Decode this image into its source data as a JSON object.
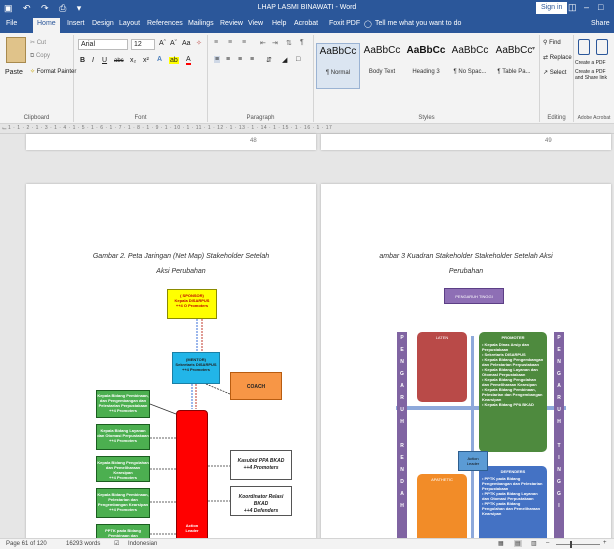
{
  "titlebar": {
    "qat": "▣ ↶ ↷ ⎙ ▾",
    "title": "LHAP LASMI BINAWATI - Word",
    "sign_in": "Sign in",
    "ribbon_display": "◫",
    "minimize": "–",
    "maximize": "□",
    "close": "✕"
  },
  "tabs": [
    "File",
    "Home",
    "Insert",
    "Design",
    "Layout",
    "References",
    "Mailings",
    "Review",
    "View",
    "Help",
    "Acrobat",
    "Foxit PDF"
  ],
  "tell_me": "Tell me what you want to do",
  "share": "Share",
  "clipboard": {
    "paste": "Paste",
    "cut": "Cut",
    "copy": "Copy",
    "format_painter": "Format Painter",
    "label": "Clipboard"
  },
  "font": {
    "name": "Arial",
    "size": "12",
    "grow": "Aˆ",
    "shrink": "Aˇ",
    "case": "Aa",
    "clear": "✧",
    "bold": "B",
    "italic": "I",
    "underline": "U",
    "strike": "abc",
    "subscript": "x₂",
    "superscript": "x²",
    "effects": "A",
    "highlight": "ab",
    "color": "A",
    "label": "Font"
  },
  "paragraph": {
    "label": "Paragraph"
  },
  "styles": {
    "items": [
      {
        "preview": "AaBbCc",
        "name": "¶ Normal"
      },
      {
        "preview": "AaBbCc",
        "name": "Body Text"
      },
      {
        "preview": "AaBbCc",
        "name": "Heading 3"
      },
      {
        "preview": "AaBbCc",
        "name": "¶ No Spac..."
      },
      {
        "preview": "AaBbCc",
        "name": "¶ Table Pa..."
      }
    ],
    "label": "Styles"
  },
  "editing": {
    "find": "Find",
    "replace": "Replace",
    "select": "Select",
    "label": "Editing"
  },
  "adobe": {
    "create_pdf": "Create a PDF",
    "create_share": "Create a PDF and Share link",
    "label": "Adobe Acrobat"
  },
  "ruler_ticks": "1 · 1 · 2 · 1 · 3 · 1 · 4 · 1 · 5 · 1 · 6 · 1 · 7 · 1 · 8 · 1 · 9 · 1 · 10 · 1 · 11 · 1 · 12 · 1 · 13 · 1 · 14 · 1 · 15 · 1 · 16 · 1 · 17",
  "pages": {
    "upper_left_number": "48",
    "upper_right_number": "49",
    "left": {
      "caption_line1": "Gambar 2. Peta Jaringan (Net Map) Stakeholder Setelah",
      "caption_line2": "Aksi Perubahan",
      "sponsor": "( SPONSOR)\nKepala DISARPUS\n++4 O Promoters",
      "mentor": "(MENTOR)\nSekretaris DISARPUS\n++4 Promoters",
      "coach": "COACH",
      "action_leader": "Action\nLeader",
      "left_boxes": [
        "Kepala Bidang Pembinaan, dan Pengembangan dan Pelestarian Perpustakaan\n++4 Promoters",
        "Kepala Bidang Layanan dan Otomasi Perpustakaan\n++4 Promoters",
        "Kepala Bidang Pengolahan dan Pemeliharaan Kearsipan\n++4 Promoters",
        "Kepala Bidang Pembinaan, Pelestarian dan Pengembangan Kearsipan\n++4 Promoters",
        "PPTK pada Bidang Pembinaan dan"
      ],
      "right_boxes": [
        "Kasubid PPA BKAD\n++4 Promoters",
        "Koordinator Relasi BKAD\n++4 Defenders"
      ]
    },
    "right": {
      "caption_line1": "ambar 3 Kuadran Stakeholder Stakeholder Setelah Aksi",
      "caption_line2": "Perubahan",
      "pengaruh": "PENGARUH TINGGI",
      "latent": "LATEN",
      "promoter_title": "PROMOTER",
      "promoter_items": "• Kepala Dinas Arsip dan Perpustakaan\n• Sekretaris DISARPUS\n• Kepala Bidang Pengembangan dan Pelestarian Perpustakaan\n• Kepala Bidang Layanan dan Otomasi Perpustakaan\n• Kepala Bidang Pengolahan dan Pemeliharaan Kearsipan\n• Kepala Bidang Pembinaan, Pelestarian dan Pengembangan Kearsipan\n• Kepala Bidang PPA BKAD",
      "apathetic": "APATHETIC",
      "defenders_title": "DEFENDERS",
      "defenders_items": "• PPTK pada Bidang Pengembangan dan Pelestarian Perpustakaan\n• PPTK pada Bidang Layanan dan Otomasi Perpustakaan\n• PPTK pada Bidang Pengolahan dan Pemeliharaan Kearsipan",
      "action_leader": "Action\nLeader",
      "left_letters": [
        "P",
        "E",
        "N",
        "G",
        "A",
        "R",
        "U",
        "H",
        "",
        "R",
        "E",
        "N",
        "D",
        "A",
        "H"
      ],
      "right_letters": [
        "P",
        "E",
        "N",
        "G",
        "A",
        "R",
        "U",
        "H",
        "",
        "T",
        "I",
        "N",
        "G",
        "G",
        "I"
      ]
    }
  },
  "status": {
    "page": "Page 61 of 120",
    "words": "16293 words",
    "proofing": "☑",
    "language": "Indonesian",
    "zoom_minus": "–",
    "zoom_plus": "+"
  },
  "colors": {
    "word_blue": "#2b579a",
    "sponsor_yellow": "#ffff00",
    "mentor_cyan": "#22b5e8",
    "coach_orange": "#f79646",
    "leader_red": "#ff0000",
    "promoter_green": "#4e8a3e",
    "latent_red": "#b94a48",
    "apathetic_orange": "#f28c28",
    "defenders_blue": "#4472c4",
    "axis_purple": "#8064a2",
    "pengaruh_purple": "#8e6fb5"
  }
}
